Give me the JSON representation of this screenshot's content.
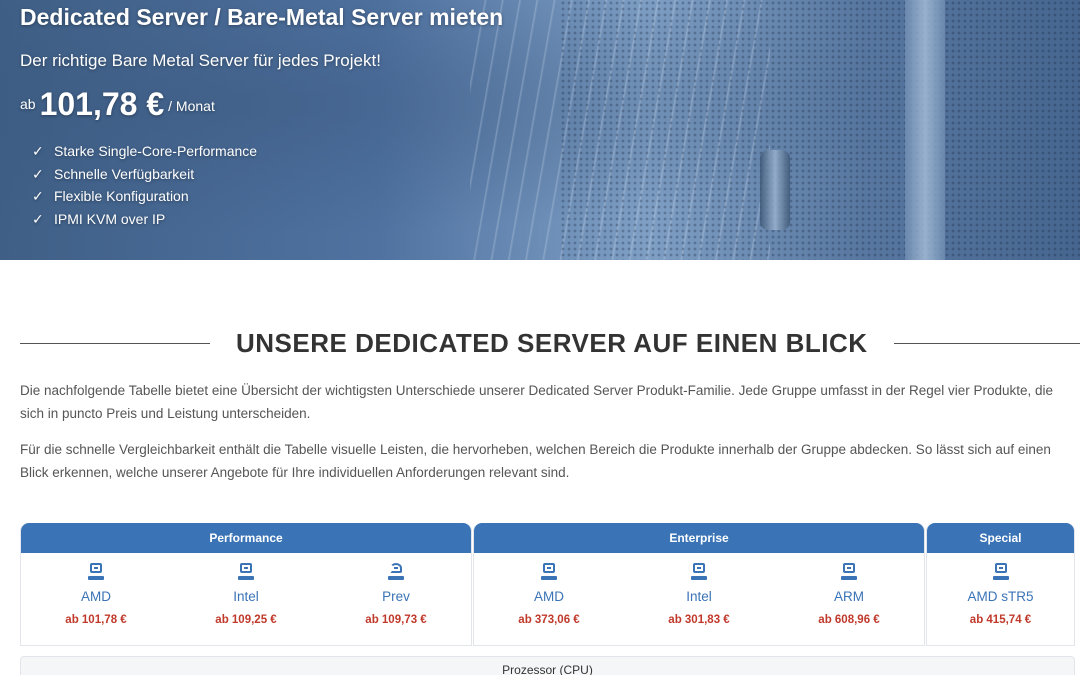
{
  "hero": {
    "title": "Dedicated Server / Bare-Metal Server mieten",
    "subtitle": "Der richtige Bare Metal Server für jedes Projekt!",
    "price_prefix": "ab",
    "price": "101,78 €",
    "price_period": "/ Monat",
    "features": [
      "Starke Single-Core-Performance",
      "Schnelle Verfügbarkeit",
      "Flexible Konfiguration",
      "IPMI KVM over IP"
    ],
    "check_glyph": "✓"
  },
  "section": {
    "title": "UNSERE DEDICATED SERVER AUF EINEN BLICK",
    "paragraphs": [
      "Die nachfolgende Tabelle bietet eine Übersicht der wichtigsten Unterschiede unserer Dedicated Server Produkt-Familie. Jede Gruppe umfasst in der Regel vier Produkte, die sich in puncto Preis und Leistung unterscheiden.",
      "Für die schnelle Vergleichbarkeit enthält die Tabelle visuelle Leisten, die hervorheben, welchen Bereich die Produkte innerhalb der Gruppe abdecken. So lässt sich auf einen Blick erkennen, welche unserer Angebote für Ihre individuellen Anforderungen relevant sind."
    ]
  },
  "table": {
    "groups": [
      {
        "name": "Performance",
        "products": [
          {
            "name": "AMD",
            "price": "ab 101,78 €",
            "icon": "server-icon"
          },
          {
            "name": "Intel",
            "price": "ab 109,25 €",
            "icon": "server-icon"
          },
          {
            "name": "Prev",
            "price": "ab 109,73 €",
            "icon": "refresh-server-icon"
          }
        ]
      },
      {
        "name": "Enterprise",
        "products": [
          {
            "name": "AMD",
            "price": "ab 373,06 €",
            "icon": "server-icon"
          },
          {
            "name": "Intel",
            "price": "ab 301,83 €",
            "icon": "server-icon"
          },
          {
            "name": "ARM",
            "price": "ab 608,96 €",
            "icon": "server-icon"
          }
        ]
      },
      {
        "name": "Special",
        "products": [
          {
            "name": "AMD sTR5",
            "price": "ab 415,74 €",
            "icon": "server-icon"
          }
        ]
      }
    ],
    "first_row_label": "Prozessor (CPU)"
  },
  "colors": {
    "accent": "#3a73b6",
    "price": "#c0392b"
  }
}
